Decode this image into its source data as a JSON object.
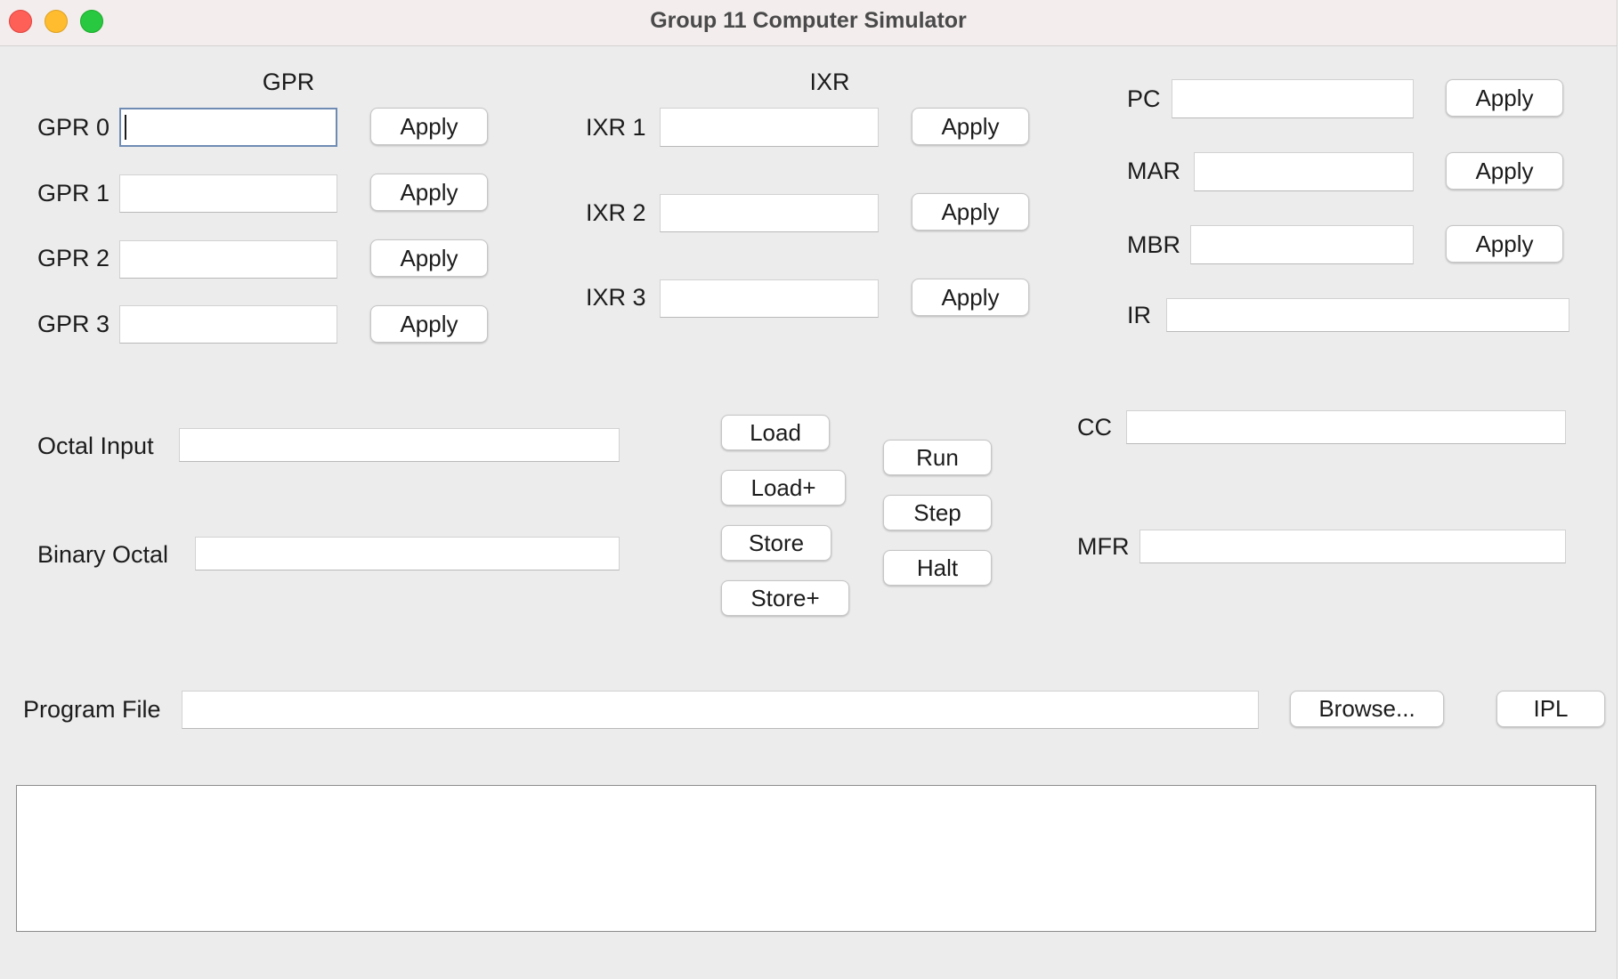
{
  "window": {
    "title": "Group 11 Computer Simulator"
  },
  "headers": {
    "gpr": "GPR",
    "ixr": "IXR"
  },
  "gpr": [
    {
      "label": "GPR 0",
      "value": "",
      "apply": "Apply"
    },
    {
      "label": "GPR 1",
      "value": "",
      "apply": "Apply"
    },
    {
      "label": "GPR 2",
      "value": "",
      "apply": "Apply"
    },
    {
      "label": "GPR 3",
      "value": "",
      "apply": "Apply"
    }
  ],
  "ixr": [
    {
      "label": "IXR 1",
      "value": "",
      "apply": "Apply"
    },
    {
      "label": "IXR 2",
      "value": "",
      "apply": "Apply"
    },
    {
      "label": "IXR 3",
      "value": "",
      "apply": "Apply"
    }
  ],
  "regs": {
    "pc": {
      "label": "PC",
      "value": "",
      "apply": "Apply"
    },
    "mar": {
      "label": "MAR",
      "value": "",
      "apply": "Apply"
    },
    "mbr": {
      "label": "MBR",
      "value": "",
      "apply": "Apply"
    },
    "ir": {
      "label": "IR",
      "value": ""
    },
    "cc": {
      "label": "CC",
      "value": ""
    },
    "mfr": {
      "label": "MFR",
      "value": ""
    }
  },
  "inputs": {
    "octal_input": {
      "label": "Octal Input",
      "value": ""
    },
    "binary_octal": {
      "label": "Binary Octal",
      "value": ""
    }
  },
  "memory_buttons": {
    "load": "Load",
    "load_plus": "Load+",
    "store": "Store",
    "store_plus": "Store+"
  },
  "control_buttons": {
    "run": "Run",
    "step": "Step",
    "halt": "Halt"
  },
  "program": {
    "label": "Program File",
    "value": "",
    "browse": "Browse...",
    "ipl": "IPL"
  },
  "console": {
    "text": ""
  }
}
